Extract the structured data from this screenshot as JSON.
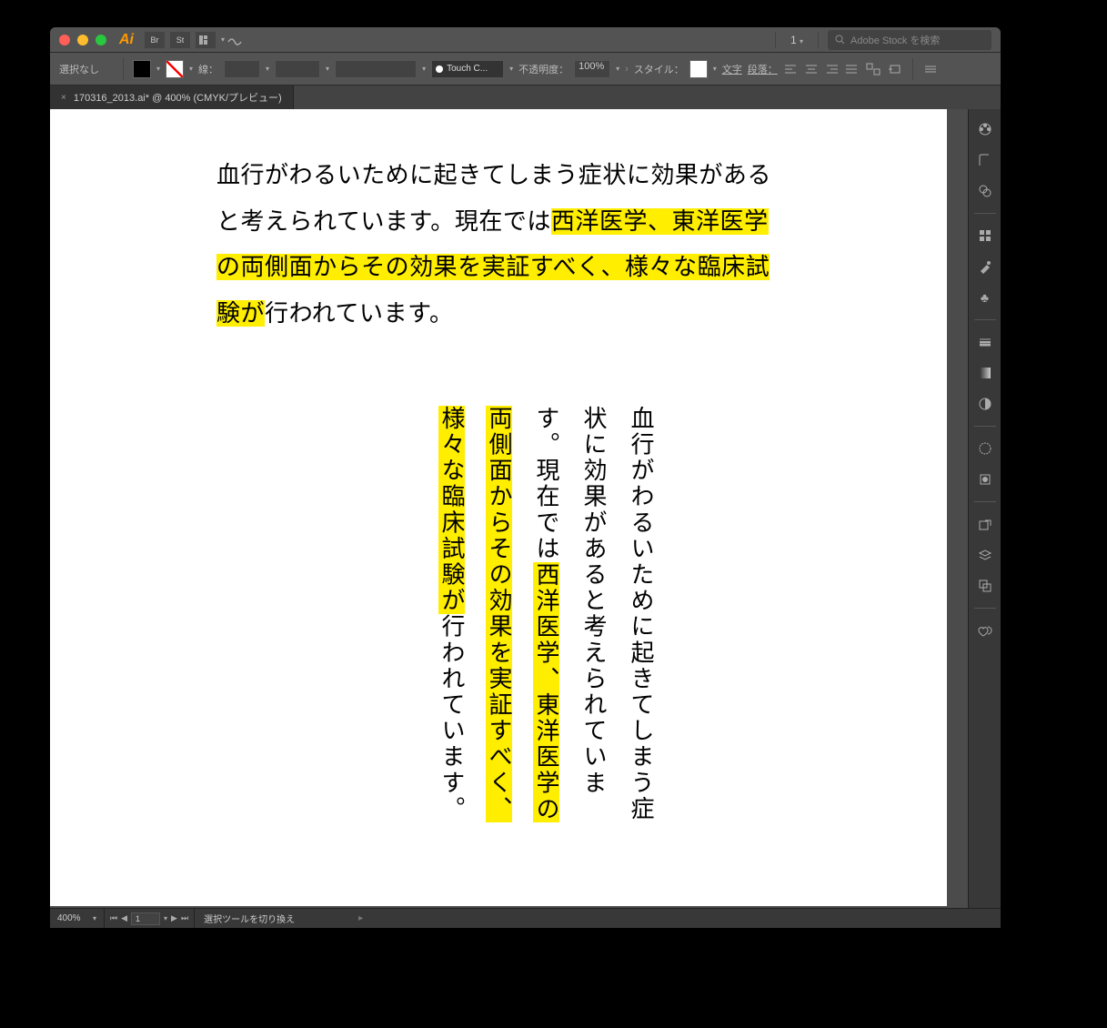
{
  "titlebar": {
    "app_letter": "Ai",
    "badge1": "Br",
    "badge2": "St",
    "workspace_num": "1",
    "stock_placeholder": "Adobe Stock を検索"
  },
  "control": {
    "selection": "選択なし",
    "stroke_label": "線：",
    "brush_label": "Touch C...",
    "opacity_label": "不透明度：",
    "opacity_value": "100%",
    "style_label": "スタイル：",
    "text_label": "文字",
    "para_label": "段落："
  },
  "tab": {
    "filename": "170316_2013.ai* @ 400% (CMYK/プレビュー)"
  },
  "document": {
    "h_para": {
      "p1": "血行がわるいために起きてしまう症状に効果があると考えられています。現在では",
      "hl1": "西洋医学、東洋医学の両側面からその効果を実証すべく、様々な臨床試験が",
      "p2": "行われています。"
    },
    "vcols": {
      "c1a": "血行がわるいために起きてしまう症",
      "c2a": "状に効果があると考えられていま",
      "c3a": "す。現在では",
      "c3h": "西洋医学、東洋医学の",
      "c4h": "両側面からその効果を実証すべく、",
      "c5h": "様々な臨床試験が",
      "c5a": "行われています。"
    }
  },
  "status": {
    "zoom": "400%",
    "artboard": "1",
    "tool_hint": "選択ツールを切り換え"
  }
}
